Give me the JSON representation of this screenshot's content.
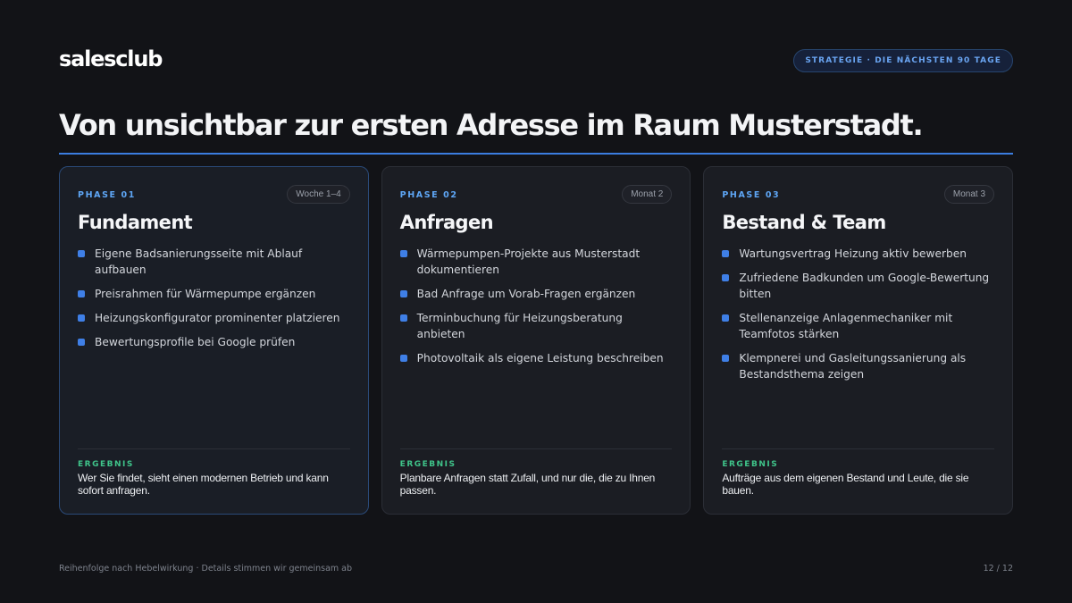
{
  "brand": {
    "logo": "salesclub"
  },
  "header": {
    "tag": "STRATEGIE · DIE NÄCHSTEN 90 TAGE",
    "title": "Von unsichtbar zur ersten Adresse im Raum Musterstadt."
  },
  "phases": [
    {
      "phase": "PHASE 01",
      "duration": "Woche 1–4",
      "title": "Fundament",
      "bullets": [
        "Eigene Badsanierungsseite mit Ablauf aufbauen",
        "Preisrahmen für Wärmepumpe ergänzen",
        "Heizungskonfigurator prominenter platzieren",
        "Bewertungsprofile bei Google prüfen"
      ],
      "result_label": "ERGEBNIS",
      "result_text": "Wer Sie findet, sieht einen modernen Betrieb und kann sofort anfragen."
    },
    {
      "phase": "PHASE 02",
      "duration": "Monat 2",
      "title": "Anfragen",
      "bullets": [
        "Wärmepumpen-Projekte aus Musterstadt dokumentieren",
        "Bad Anfrage um Vorab-Fragen ergänzen",
        "Terminbuchung für Heizungsberatung anbieten",
        "Photovoltaik als eigene Leistung beschreiben"
      ],
      "result_label": "ERGEBNIS",
      "result_text": "Planbare Anfragen statt Zufall, und nur die, die zu Ihnen passen."
    },
    {
      "phase": "PHASE 03",
      "duration": "Monat 3",
      "title": "Bestand & Team",
      "bullets": [
        "Wartungsvertrag Heizung aktiv bewerben",
        "Zufriedene Badkunden um Google-Bewertung bitten",
        "Stellenanzeige Anlagenmechaniker mit Teamfotos stärken",
        "Klempnerei und Gasleitungssanierung als Bestandsthema zeigen"
      ],
      "result_label": "ERGEBNIS",
      "result_text": "Aufträge aus dem eigenen Bestand und Leute, die sie bauen."
    }
  ],
  "footer": {
    "note": "Reihenfolge nach Hebelwirkung · Details stimmen wir gemeinsam ab",
    "page": "12 / 12"
  },
  "colors": {
    "background": "#121317",
    "accent_blue": "#3f7fe6",
    "phase_label": "#5ea6f5",
    "result_green": "#3fc48a",
    "card_bg": "#1b1d23"
  }
}
